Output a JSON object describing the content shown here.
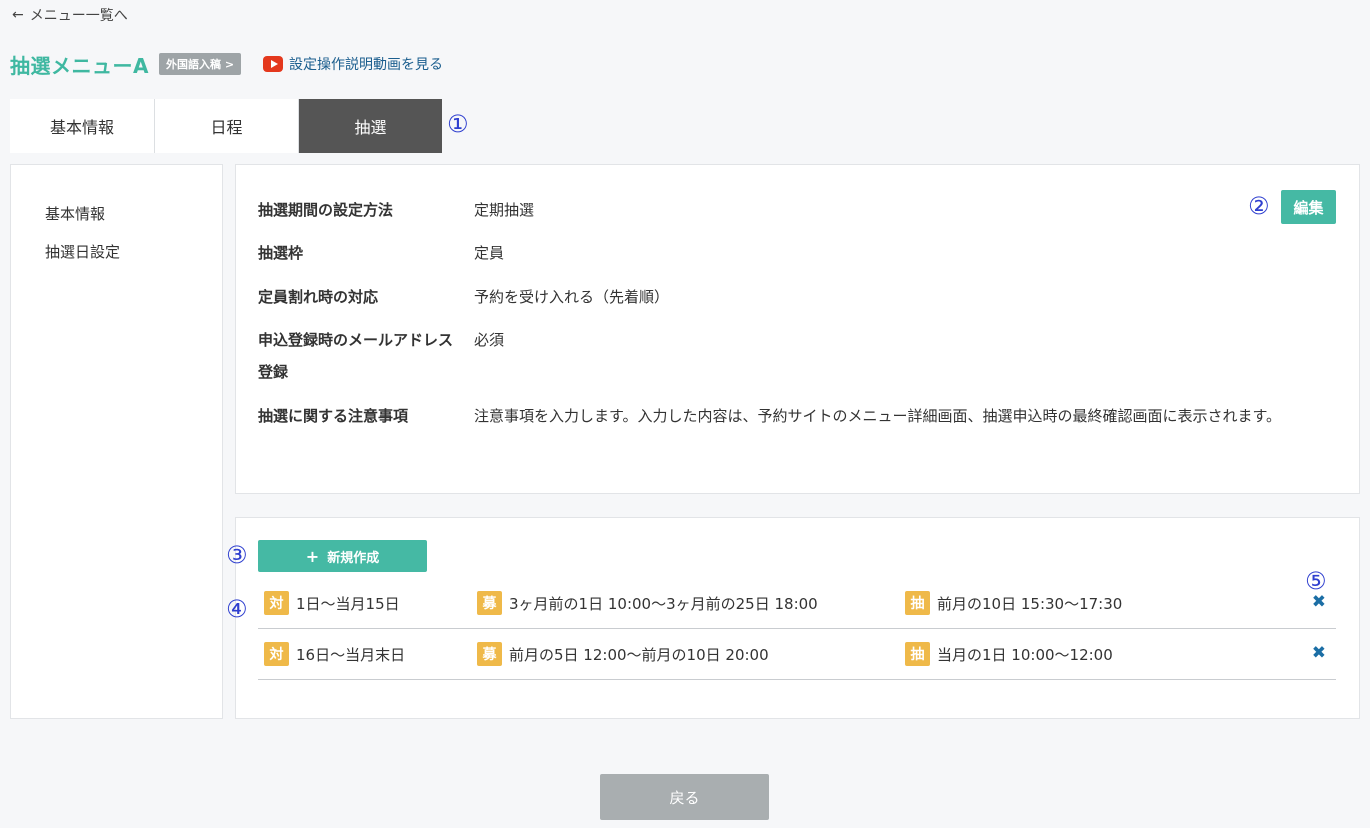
{
  "nav": {
    "back_label": "メニュー一覧へ",
    "back_icon": "arrow-left-icon"
  },
  "header": {
    "title": "抽選メニューA",
    "lang_badge": "外国語入稿 >",
    "video_link": "設定操作説明動画を見る",
    "title_color": "#3fb8a1"
  },
  "tabs": [
    {
      "label": "基本情報"
    },
    {
      "label": "日程"
    },
    {
      "label": "抽選",
      "active": true
    }
  ],
  "markers": {
    "m1": "①",
    "m2": "②",
    "m3": "③",
    "m4": "④",
    "m5": "⑤"
  },
  "sidebar": {
    "items": [
      {
        "label": "基本情報"
      },
      {
        "label": "抽選日設定"
      }
    ]
  },
  "info": {
    "edit_label": "編集",
    "rows": [
      {
        "label": "抽選期間の設定方法",
        "value": "定期抽選"
      },
      {
        "label": "抽選枠",
        "value": "定員"
      },
      {
        "label": "定員割れ時の対応",
        "value": "予約を受け入れる（先着順）"
      },
      {
        "label": "申込登録時のメールアドレス登録",
        "value": "必須"
      },
      {
        "label": "抽選に関する注意事項",
        "value": "注意事項を入力します。入力した内容は、予約サイトのメニュー詳細画面、抽選申込時の最終確認画面に表示されます。"
      }
    ]
  },
  "schedules": {
    "new_label": "新規作成",
    "rows": [
      {
        "target_tag": "対",
        "target": "1日〜当月15日",
        "recruit_tag": "募",
        "recruit": "3ヶ月前の1日 10:00〜3ヶ月前の25日 18:00",
        "draw_tag": "抽",
        "draw": "前月の10日 15:30〜17:30"
      },
      {
        "target_tag": "対",
        "target": "16日〜当月末日",
        "recruit_tag": "募",
        "recruit": "前月の5日 12:00〜前月の10日 20:00",
        "draw_tag": "抽",
        "draw": "当月の1日 10:00〜12:00"
      }
    ]
  },
  "footer": {
    "back_button": "戻る"
  },
  "colors": {
    "accent": "#45b9a4",
    "tag": "#efb949",
    "active_tab": "#555555",
    "marker": "#2f3fcf"
  }
}
